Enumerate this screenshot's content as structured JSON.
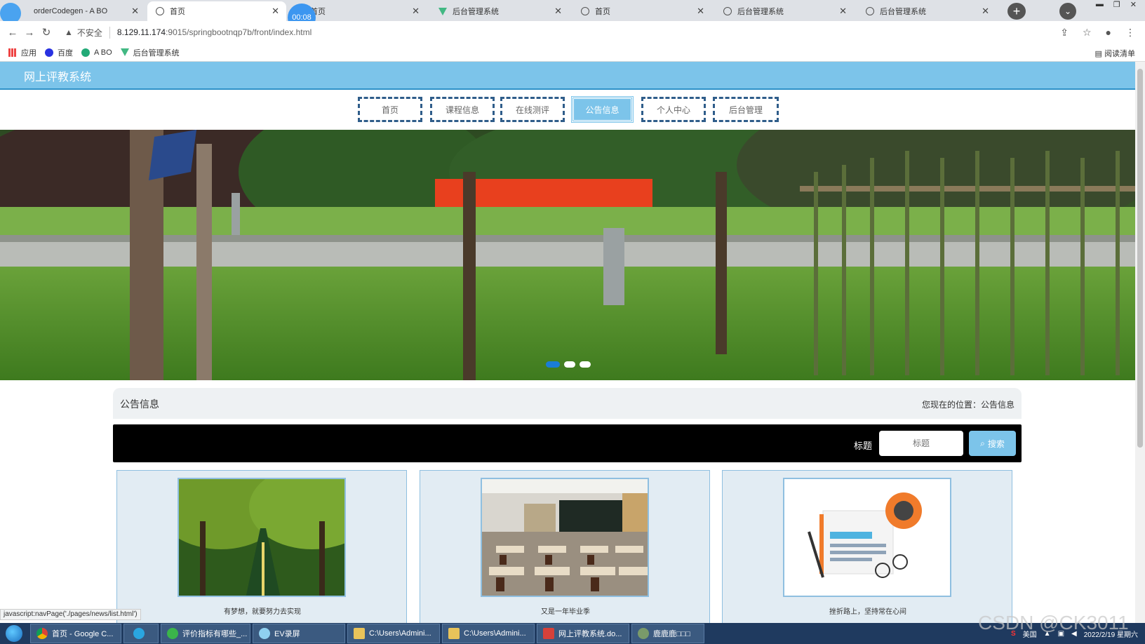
{
  "browser": {
    "tabs": [
      {
        "title": "orderCodegen - A BO",
        "icon": "recording-icon"
      },
      {
        "title": "首页",
        "icon": "globe-icon",
        "active": true
      },
      {
        "title": "首页",
        "icon": "globe-icon"
      },
      {
        "title": "后台管理系统",
        "icon": "vue-icon"
      },
      {
        "title": "首页",
        "icon": "globe-icon"
      },
      {
        "title": "后台管理系统",
        "icon": "globe-icon"
      },
      {
        "title": "后台管理系统",
        "icon": "globe-icon"
      }
    ],
    "recording_timer": "00:08",
    "security_label": "不安全",
    "url_host": "8.129.11.174",
    "url_path": ":9015/springbootnqp7b/front/index.html",
    "bookmarks": [
      "应用",
      "百度",
      "A BO",
      "后台管理系统"
    ],
    "reading_list": "阅读清单"
  },
  "site": {
    "title": "网上评教系统",
    "nav": [
      {
        "label": "首页",
        "active": false
      },
      {
        "label": "课程信息",
        "active": false
      },
      {
        "label": "在线测评",
        "active": false
      },
      {
        "label": "公告信息",
        "active": true
      },
      {
        "label": "个人中心",
        "active": false
      },
      {
        "label": "后台管理",
        "active": false
      }
    ],
    "banner_active_dot": 1,
    "section_title": "公告信息",
    "location": "您现在的位置：公告信息",
    "search": {
      "label": "标题",
      "placeholder": "标题",
      "button": "搜索"
    },
    "cards": [
      {
        "caption": "有梦想，就要努力去实现"
      },
      {
        "caption": "又是一年毕业季"
      },
      {
        "caption": "挫折路上，坚持常在心间"
      }
    ],
    "status_url": "javascript:navPage('./pages/news/list.html')"
  },
  "taskbar": {
    "items": [
      "首页 - Google C...",
      "",
      "评价指标有哪些_...",
      "EV录屏",
      "C:\\Users\\Admini...",
      "C:\\Users\\Admini...",
      "网上评教系统.do...",
      "鹿鹿鹿□□□"
    ],
    "tray_text": "美国",
    "date": "2022/2/19 星期六"
  },
  "watermark": "CSDN @CK3011",
  "colors": {
    "header": "#7cc4ea",
    "nav_active": "#7cc4ea",
    "search_band": "#000000"
  }
}
